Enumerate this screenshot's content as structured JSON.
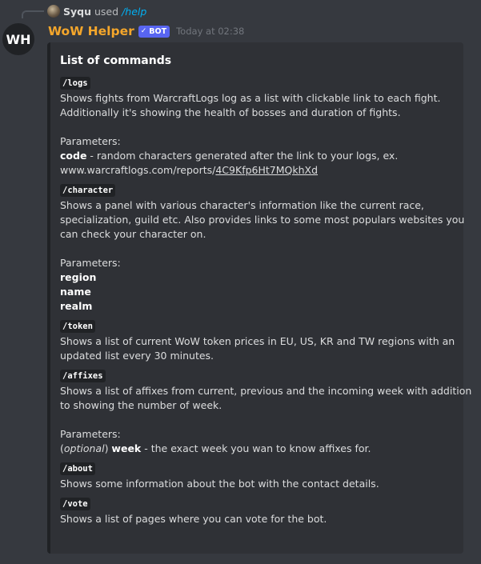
{
  "reply": {
    "user": "Syqu",
    "used": "used",
    "command": "/help"
  },
  "message": {
    "avatar_text": "WH",
    "username": "WoW Helper",
    "bot_tag": "BOT",
    "bot_check": "✓",
    "timestamp": "Today at 02:38"
  },
  "embed": {
    "title": "List of commands",
    "fields": {
      "logs": {
        "name": "/logs",
        "desc1": "Shows fights from WarcraftLogs log as a list with clickable link to each fight.",
        "desc2": "Additionally it's showing the health of bosses and duration of fights.",
        "params_label": "Parameters:",
        "param_code": "code",
        "param_code_desc": " - random characters generated after the link to your logs, ex.",
        "url_prefix": "www.warcraftlogs.com/reports/",
        "url_code": "4C9Kfp6Ht7MQkhXd"
      },
      "character": {
        "name": "/character",
        "desc1": "Shows a panel with various character's information like the current race,",
        "desc2": "specialization, guild etc. Also provides links to some most populars websites you",
        "desc3": "can check your character on.",
        "params_label": "Parameters:",
        "param1": "region",
        "param2": "name",
        "param3": "realm"
      },
      "token": {
        "name": "/token",
        "desc1": "Shows a list of current WoW token prices in EU, US, KR and TW regions with an",
        "desc2": "updated list every 30 minutes."
      },
      "affixes": {
        "name": "/affixes",
        "desc1": "Shows a list of affixes from current, previous and the incoming week with addition",
        "desc2": "to showing the number of week.",
        "params_label": "Parameters:",
        "param_prefix": "(",
        "param_optional": "optional",
        "param_suffix": ") ",
        "param_week": "week",
        "param_week_desc": " - the exact week you wan to know affixes for."
      },
      "about": {
        "name": "/about",
        "desc1": "Shows some information about the bot with the contact details."
      },
      "vote": {
        "name": "/vote",
        "desc1": "Shows a list of pages where you can vote for the bot."
      }
    }
  }
}
